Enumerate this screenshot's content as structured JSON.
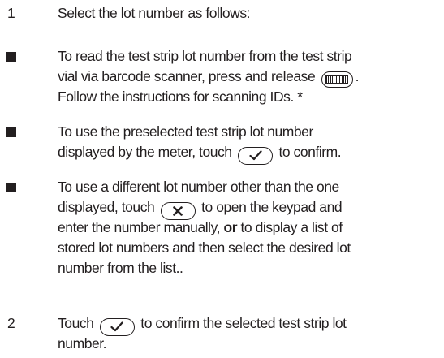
{
  "steps": [
    {
      "number": "1",
      "text": "Select the lot number as follows:"
    },
    {
      "number": "2",
      "line1_before": "Touch",
      "line1_after": "to confirm the selected test strip lot",
      "line2": "number.",
      "button_icon": "check-icon"
    }
  ],
  "options": [
    {
      "line1": "To read the test strip lot number from the test strip",
      "line2_before": "vial via barcode scanner, press and release",
      "line2_after": ".",
      "line3": "Follow the instructions for scanning IDs. *",
      "button_icon": "barcode-icon"
    },
    {
      "line1": "To use the preselected test strip lot number",
      "line2_before": "displayed by the meter, touch",
      "line2_after": "to confirm.",
      "button_icon": "check-icon"
    },
    {
      "line1": "To use a different lot number other than the one",
      "line2_before": "displayed, touch",
      "line2_after": "to open the keypad and",
      "line3_before": "enter the number manually,",
      "line3_bold": "or",
      "line3_after": "to display a list of",
      "line4": "stored lot numbers and then select the desired lot",
      "line5": "number from the list..",
      "button_icon": "x-icon"
    }
  ]
}
